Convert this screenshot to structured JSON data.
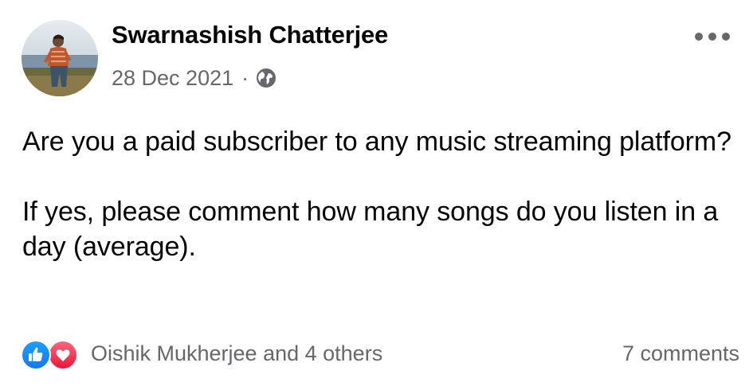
{
  "post": {
    "author": "Swarnashish Chatterjee",
    "date": "28 Dec 2021",
    "separator": "·",
    "privacy_icon": "globe-icon",
    "more_icon": "more-horizontal-icon",
    "text": [
      "Are you a paid subscriber to any music streaming platform?",
      "If yes, please comment how many songs do you listen in a day (average)."
    ]
  },
  "reactions": {
    "icons": [
      "like-icon",
      "love-icon"
    ],
    "summary": "Oishik Mukherjee and 4 others",
    "count": 5
  },
  "comments": {
    "label": "7 comments",
    "count": 7
  },
  "colors": {
    "primary_text": "#050505",
    "secondary_text": "#65676b",
    "like_blue": "#1877f2",
    "love_red": "#f33e58",
    "background": "#ffffff"
  }
}
